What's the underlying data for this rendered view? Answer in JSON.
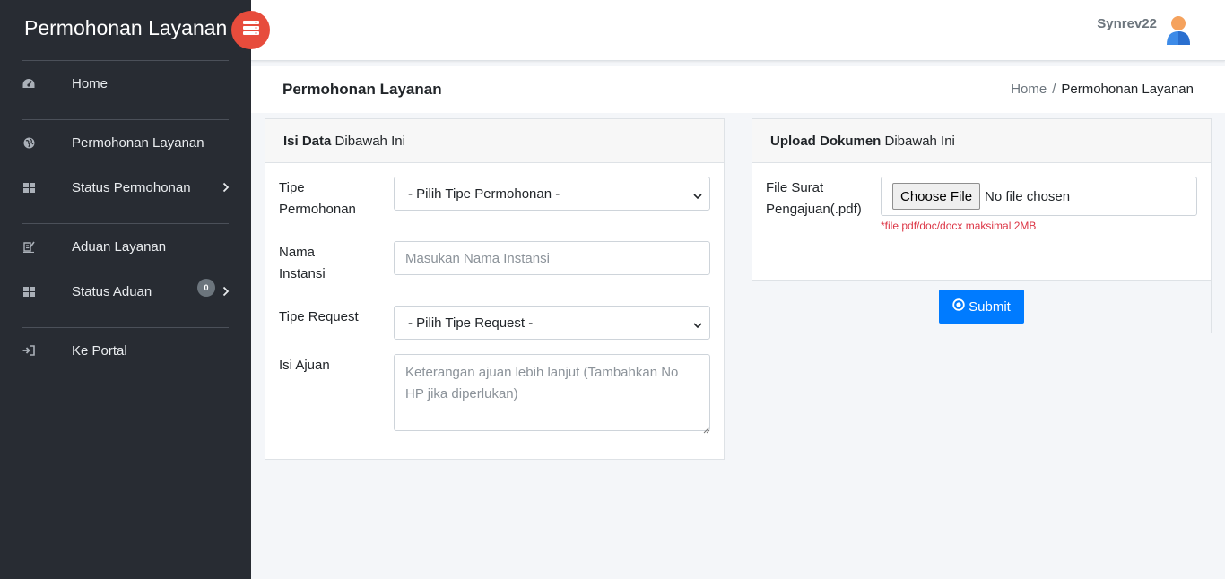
{
  "sidebar": {
    "brand": "Permohonan Layanan",
    "toggle_icon": "server-icon",
    "items": [
      {
        "label": "Home",
        "icon": "dashboard-icon"
      },
      {
        "label": "Permohonan Layanan",
        "icon": "globe-icon"
      },
      {
        "label": "Status Permohonan",
        "icon": "grid-icon",
        "has_submenu": true
      },
      {
        "label": "Aduan Layanan",
        "icon": "file-signature-icon"
      },
      {
        "label": "Status Aduan",
        "icon": "grid-icon",
        "badge": "0",
        "has_submenu": true
      },
      {
        "label": "Ke Portal",
        "icon": "sign-in-icon"
      }
    ]
  },
  "topbar": {
    "username": "Synrev22"
  },
  "header": {
    "title": "Permohonan Layanan",
    "breadcrumb": {
      "home": "Home",
      "separator": "/",
      "current": "Permohonan Layanan"
    }
  },
  "form_card": {
    "title_bold": "Isi Data",
    "title_rest": "Dibawah Ini",
    "fields": {
      "tipe_permohonan": {
        "label_line1": "Tipe",
        "label_line2": "Permohonan",
        "selected": "- Pilih Tipe Permohonan -"
      },
      "nama_instansi": {
        "label_line1": "Nama",
        "label_line2": "Instansi",
        "placeholder": "Masukan Nama Instansi"
      },
      "tipe_request": {
        "label": "Tipe Request",
        "selected": "- Pilih Tipe Request -"
      },
      "isi_ajuan": {
        "label": "Isi Ajuan",
        "placeholder": "Keterangan ajuan lebih lanjut (Tambahkan No HP jika diperlukan)"
      }
    }
  },
  "upload_card": {
    "title_bold": "Upload Dokumen",
    "title_rest": "Dibawah Ini",
    "file_label_line1": "File Surat",
    "file_label_line2": "Pengajuan(.pdf)",
    "choose_button": "Choose File",
    "file_status": "No file chosen",
    "hint": "*file pdf/doc/docx maksimal 2MB",
    "submit_label": "Submit"
  },
  "colors": {
    "sidebar_bg": "#282c33",
    "accent_red": "#e74c3c",
    "primary": "#007bff",
    "danger": "#dc3545"
  }
}
